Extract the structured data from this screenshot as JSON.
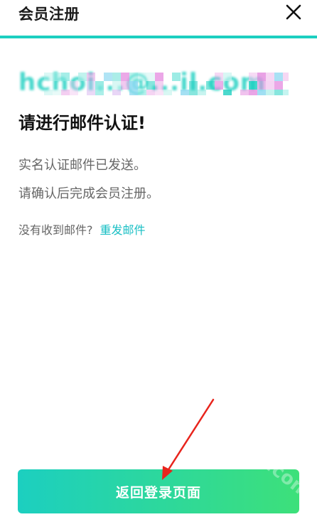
{
  "header": {
    "title": "会员注册",
    "close_icon": "close-icon"
  },
  "colors": {
    "accent": "#1ccfc0",
    "accent_end": "#3de07a",
    "link": "#18bfc4",
    "text_dark": "#111111",
    "text_muted": "#666666"
  },
  "email": {
    "display": "hchoi...@...il.com"
  },
  "main": {
    "heading": "请进行邮件认证!",
    "line1": "实名认证邮件已发送。",
    "line2": "请确认后完成会员注册。",
    "resend_prompt": "没有收到邮件?",
    "resend_link": "重发邮件"
  },
  "footer": {
    "back_button": "返回登录页面"
  },
  "watermark": "nz.com"
}
